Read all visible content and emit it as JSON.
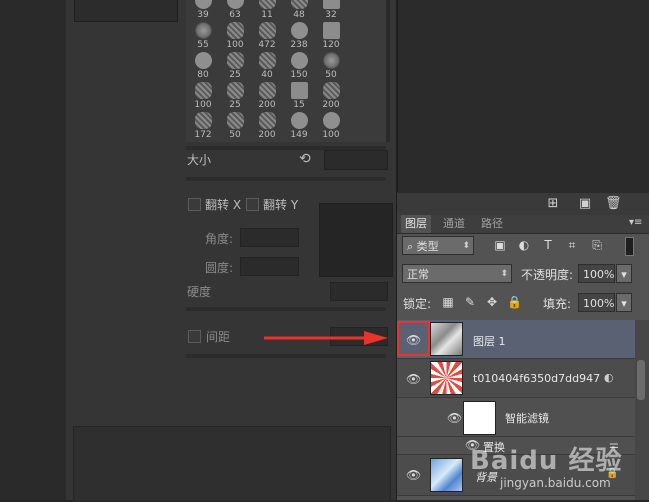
{
  "brush_panel": {
    "tips": [
      {
        "size": "39",
        "kind": "hard"
      },
      {
        "size": "63",
        "kind": "hard"
      },
      {
        "size": "11",
        "kind": "tex"
      },
      {
        "size": "48",
        "kind": "tex"
      },
      {
        "size": "32",
        "kind": "sq"
      },
      {
        "size": "55",
        "kind": "soft"
      },
      {
        "size": "100",
        "kind": "tex"
      },
      {
        "size": "472",
        "kind": "tex"
      },
      {
        "size": "238",
        "kind": "hard"
      },
      {
        "size": "120",
        "kind": "sq"
      },
      {
        "size": "80",
        "kind": "hard"
      },
      {
        "size": "25",
        "kind": "tex"
      },
      {
        "size": "40",
        "kind": "tex"
      },
      {
        "size": "150",
        "kind": "hard"
      },
      {
        "size": "50",
        "kind": "soft"
      },
      {
        "size": "100",
        "kind": "tex"
      },
      {
        "size": "25",
        "kind": "tex"
      },
      {
        "size": "200",
        "kind": "tex"
      },
      {
        "size": "15",
        "kind": "sq"
      },
      {
        "size": "200",
        "kind": "tex"
      },
      {
        "size": "172",
        "kind": "tex"
      },
      {
        "size": "50",
        "kind": "tex"
      },
      {
        "size": "200",
        "kind": "tex"
      },
      {
        "size": "149",
        "kind": "hard"
      },
      {
        "size": "100",
        "kind": "hard"
      }
    ],
    "size_label": "大小",
    "flip_x_label": "翻转 X",
    "flip_y_label": "翻转 Y",
    "angle_label": "角度:",
    "roundness_label": "圆度:",
    "hardness_label": "硬度",
    "spacing_label": "间距"
  },
  "layers_panel": {
    "tabs": [
      "图层",
      "通道",
      "路径"
    ],
    "filter_kind": "类型",
    "blend_mode": "正常",
    "opacity_label": "不透明度:",
    "opacity_value": "100%",
    "lock_label": "锁定:",
    "fill_label": "填充:",
    "fill_value": "100%",
    "layers": [
      {
        "name": "图层 1"
      },
      {
        "name": "t010404f6350d7dd947"
      },
      {
        "name": "智能滤镜"
      },
      {
        "name": "置换"
      },
      {
        "name": "背景"
      }
    ]
  },
  "watermark": {
    "logo": "Baidu 经验",
    "url": "jingyan.baidu.com"
  },
  "colors": {
    "selected_layer": "#596172",
    "highlight_red": "#e8342a"
  }
}
